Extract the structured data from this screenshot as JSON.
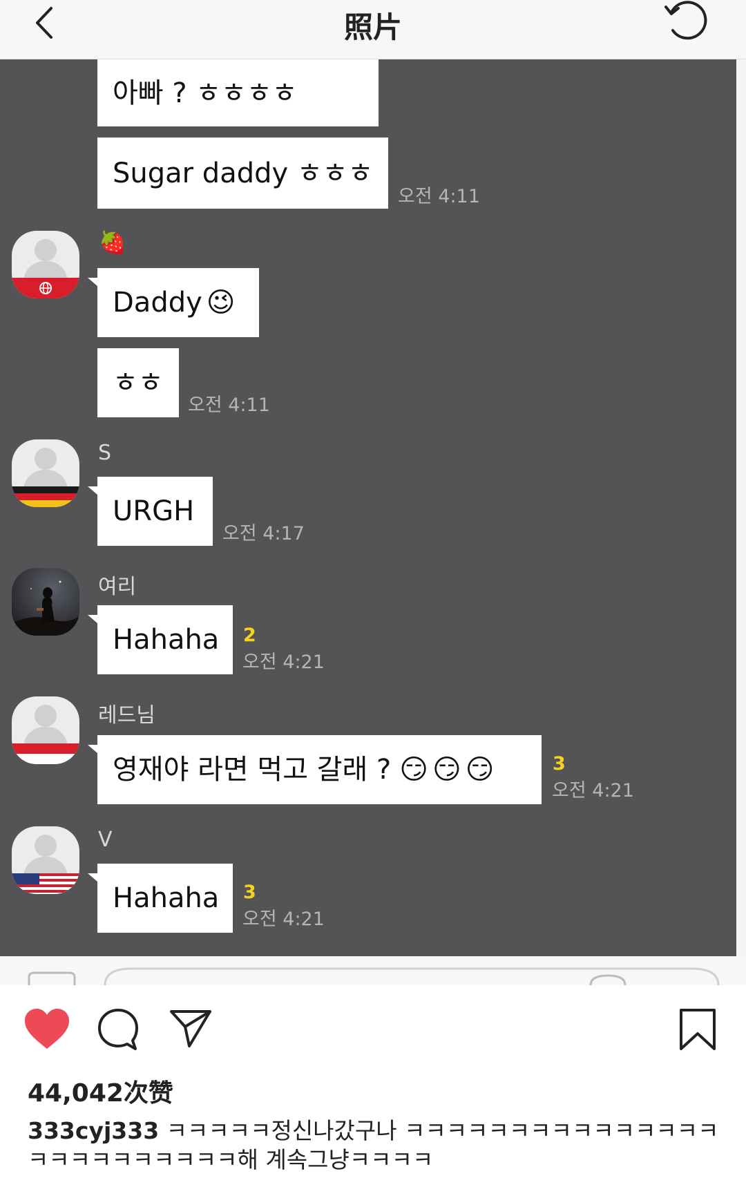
{
  "nav": {
    "title": "照片"
  },
  "chat": {
    "messages": {
      "m1": "아빠 ? ㅎㅎㅎㅎ",
      "m2": "Sugar daddy ㅎㅎㅎ",
      "m3": "Daddy",
      "m4": "ㅎㅎ",
      "m5": "URGH",
      "m6": "Hahaha",
      "m7": "영재야 라면 먹고 갈래 ?",
      "m8": "Hahaha"
    },
    "emoji": {
      "strawberry": "🍓",
      "wink": "😉",
      "smirk": "😏😏😏"
    },
    "senders": {
      "s2": "S",
      "s3": "여리",
      "s4": "레드님",
      "s5": "V"
    },
    "times": {
      "t1": "오전 4:11",
      "t2": "오전 4:11",
      "t3": "오전 4:17",
      "t4": "오전 4:21",
      "t5": "오전 4:21",
      "t6": "오전 4:21"
    },
    "unread": {
      "u1": "2",
      "u2": "3",
      "u3": "3"
    },
    "colors": {
      "background": "#545457",
      "bubble": "#ffffff",
      "unread": "#f4d21f"
    }
  },
  "post": {
    "likes": "44,042次赞",
    "username": "333cyj333",
    "caption": "ㅋㅋㅋㅋㅋ정신나갔구나 ㅋㅋㅋㅋㅋㅋㅋㅋㅋㅋㅋㅋㅋㅋㅋㅋㅋㅋㅋㅋㅋㅋㅋㅋㅋ해 계속그냥ㅋㅋㅋㅋ",
    "colors": {
      "heart": "#ed4956"
    }
  }
}
